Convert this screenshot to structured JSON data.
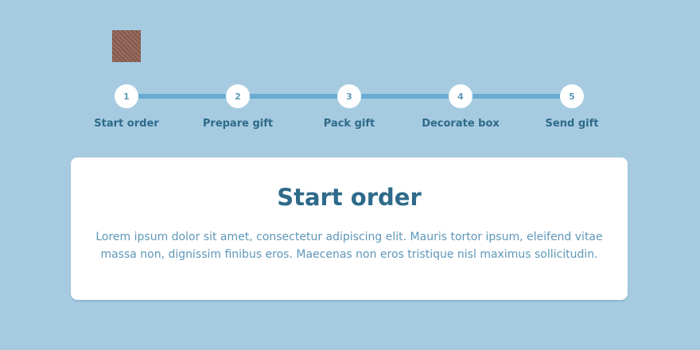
{
  "header": {
    "icon": "gift-box-icon"
  },
  "stepper": {
    "active_index": 0,
    "steps": [
      {
        "number": "1",
        "label": "Start order"
      },
      {
        "number": "2",
        "label": "Prepare gift"
      },
      {
        "number": "3",
        "label": "Pack gift"
      },
      {
        "number": "4",
        "label": "Decorate box"
      },
      {
        "number": "5",
        "label": "Send gift"
      }
    ]
  },
  "card": {
    "title": "Start order",
    "text": "Lorem ipsum dolor sit amet, consectetur adipiscing elit. Mauris tortor ipsum, eleifend vitae massa non, dignissim finibus eros. Maecenas non eros tristique nisl maximus sollicitudin."
  },
  "colors": {
    "background": "#a6cbe1",
    "track": "#6aabd2",
    "heading": "#2e6a8a",
    "body_text": "#5e97b8",
    "card": "#ffffff"
  }
}
